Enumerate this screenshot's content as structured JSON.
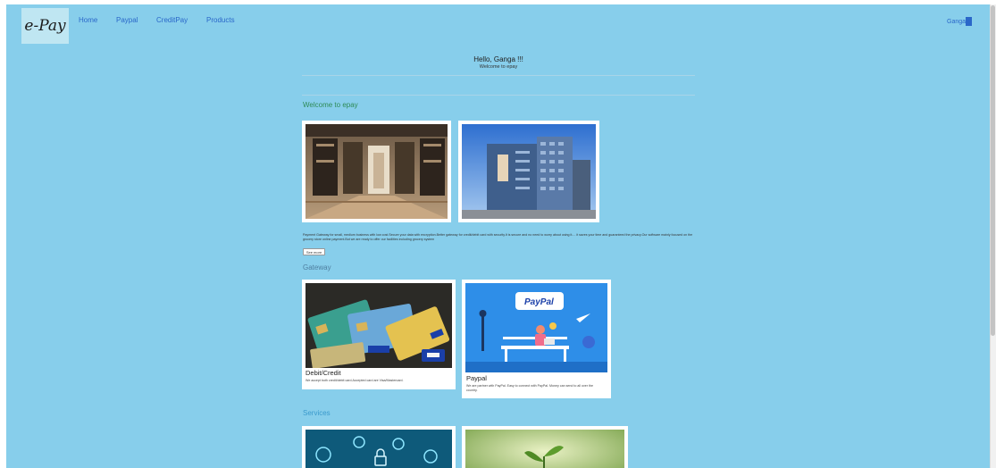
{
  "nav": {
    "logo": "e-Pay",
    "items": [
      "Home",
      "Paypal",
      "CreditPay",
      "Products"
    ],
    "user": "Ganga"
  },
  "greeting": {
    "hello": "Hello, Ganga !!!",
    "sub": "Welcome to epay"
  },
  "welcome": {
    "heading": "Welcome to epay",
    "description": "Payment Gateway for small, medium business with low cost.Secure your data with encryption.Better gateway for credit/debit card with security.It is secure and no need to worry about using it.... it saves your time and guaranteed the privacy.Our software mainly focused on the grocery store online payment.But we are ready to offer our facilities including grocery system",
    "see_more": "See more"
  },
  "gateway": {
    "heading": "Gateway",
    "cards": [
      {
        "title": "Debit/Credit",
        "text": "We accept both credit/debit card.Accepted card are Visa/Mastercard."
      },
      {
        "title": "Paypal",
        "text": "We are partner with PayPal. Easy to connect with PayPal. Money can send to all over the country.",
        "logo_text": "PayPal"
      }
    ]
  },
  "services": {
    "heading": "Services"
  }
}
